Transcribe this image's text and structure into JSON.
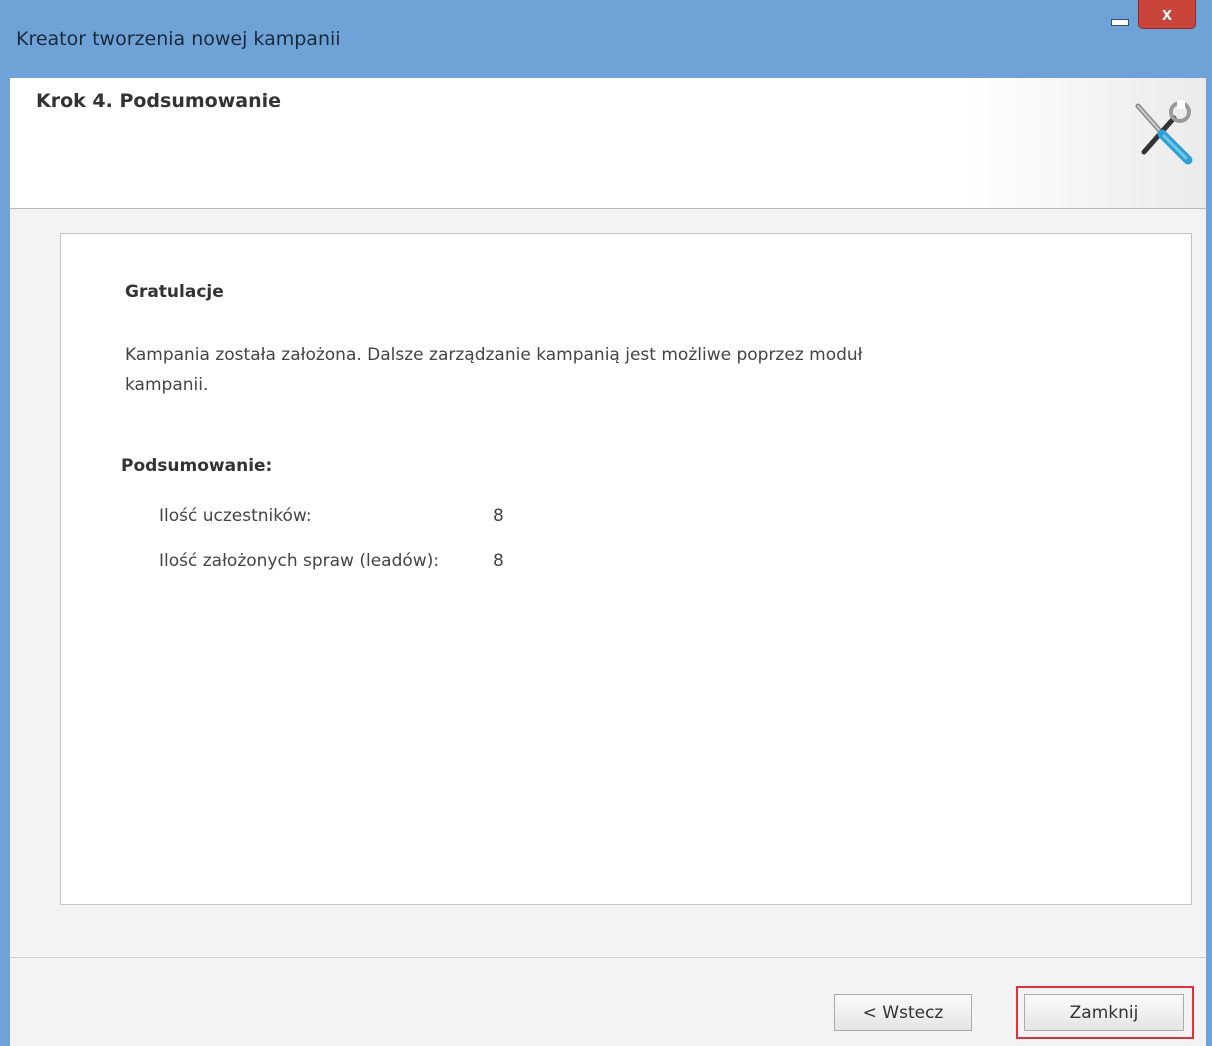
{
  "window": {
    "title": "Kreator tworzenia nowej kampanii",
    "close_glyph": "x"
  },
  "header": {
    "step_title": "Krok 4. Podsumowanie",
    "icon": "tools-icon"
  },
  "content": {
    "heading": "Gratulacje",
    "message": "Kampania została założona. Dalsze zarządzanie kampanią jest możliwe poprzez moduł kampanii.",
    "summary_heading": "Podsumowanie:",
    "summary_rows": [
      {
        "label": "Ilość uczestników:",
        "value": "8"
      },
      {
        "label": "Ilość założonych spraw (leadów):",
        "value": "8"
      }
    ]
  },
  "footer": {
    "back_label": "< Wstecz",
    "close_label": "Zamknij",
    "highlight_color": "#d9333f"
  }
}
